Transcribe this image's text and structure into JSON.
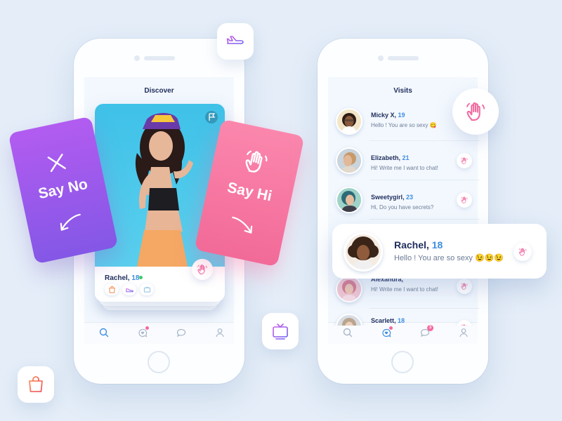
{
  "colors": {
    "background": "#e4edf8",
    "title": "#1f2d5c",
    "age_accent": "#3d8ee0",
    "say_no_gradient": [
      "#b25cf0",
      "#8457e6"
    ],
    "say_hi_gradient": [
      "#fb87ad",
      "#f26a98"
    ],
    "online": "#41c96b",
    "badge": "#f56aa0"
  },
  "left_screen": {
    "title": "Discover",
    "profile": {
      "name": "Rachel,",
      "age": "18",
      "status": "online",
      "interest_icons": [
        "shopping-bag-icon",
        "sneaker-icon",
        "tv-icon"
      ],
      "flag_icon": "flag-icon",
      "hi_icon": "waving-hand-icon"
    },
    "say_no": {
      "label": "Say No",
      "icon": "x-icon",
      "arrow": "arrow-down-left-icon"
    },
    "say_hi": {
      "label": "Say Hi",
      "icon": "waving-hand-icon",
      "arrow": "arrow-down-right-icon"
    },
    "tabs": [
      "search-icon",
      "heart-bubble-icon",
      "chat-icon",
      "profile-icon"
    ]
  },
  "right_screen": {
    "title": "Visits",
    "visits": [
      {
        "name": "Micky X,",
        "age": "19",
        "message": "Hello ! You are so sexy 😋"
      },
      {
        "name": "Elizabeth,",
        "age": "21",
        "message": "Hi! Write me I want to chat!"
      },
      {
        "name": "Sweetygirl,",
        "age": "23",
        "message": "Hi, Do you have secrets?"
      },
      {
        "name": "Alexandra,",
        "age": "",
        "message": "Hi! Write me I want to chat!"
      },
      {
        "name": "Scarlett,",
        "age": "18",
        "message": ""
      }
    ],
    "popup": {
      "name": "Rachel,",
      "age": "18",
      "message": "Hello ! You are so sexy 😉😉😉"
    },
    "tabs": [
      "search-icon",
      "heart-bubble-icon",
      "chat-icon",
      "profile-icon"
    ],
    "chat_badge": "3"
  },
  "floating_icons": [
    "airplane-icon",
    "tv-icon",
    "shopping-bag-icon",
    "waving-hand-icon"
  ]
}
